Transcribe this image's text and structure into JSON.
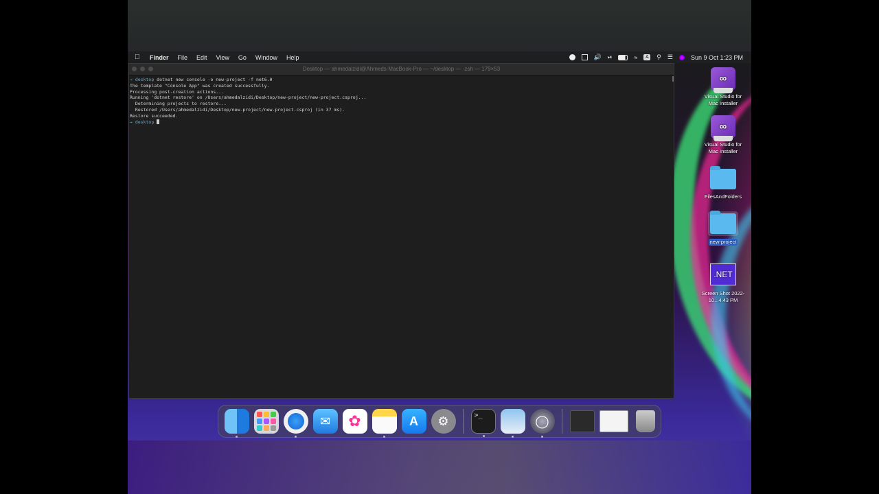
{
  "menubar": {
    "app_name": "Finder",
    "menus": [
      "File",
      "Edit",
      "View",
      "Go",
      "Window",
      "Help"
    ],
    "clock": "Sun 9 Oct  1:23 PM",
    "status_icons": [
      "screen-record-icon",
      "control-grid-icon",
      "volume-icon",
      "play-icon",
      "battery-icon",
      "wifi-icon",
      "input-source-icon",
      "search-icon",
      "control-center-icon",
      "siri-icon"
    ]
  },
  "terminal": {
    "title": "Desktop — ahmedalzidi@Ahmeds-MacBook-Pro — ~/desktop — -zsh — 179×53",
    "lines": [
      {
        "prompt": true,
        "dir": "desktop",
        "text": "dotnet new console -o new-project -f net6.0"
      },
      {
        "prompt": false,
        "text": "The template \"Console App\" was created successfully."
      },
      {
        "prompt": false,
        "text": ""
      },
      {
        "prompt": false,
        "text": "Processing post-creation actions..."
      },
      {
        "prompt": false,
        "text": "Running 'dotnet restore' on /Users/ahmedalzidi/Desktop/new-project/new-project.csproj..."
      },
      {
        "prompt": false,
        "text": "  Determining projects to restore..."
      },
      {
        "prompt": false,
        "text": "  Restored /Users/ahmedalzidi/Desktop/new-project/new-project.csproj (in 37 ms)."
      },
      {
        "prompt": false,
        "text": "Restore succeeded."
      },
      {
        "prompt": false,
        "text": ""
      }
    ],
    "current_prompt": {
      "arrow": "→",
      "dir": "desktop"
    }
  },
  "desktop_icons": [
    {
      "name": "vs-installer-1",
      "label": "Visual Studio for Mac Installer",
      "kind": "vs"
    },
    {
      "name": "vs-installer-2",
      "label": "Visual Studio for Mac Installer",
      "kind": "vs"
    },
    {
      "name": "files-and-folders",
      "label": "FilesAndFolders",
      "kind": "folder"
    },
    {
      "name": "new-project",
      "label": "new-project",
      "kind": "folder",
      "selected": true
    },
    {
      "name": "screen-shot",
      "label": "Screen Shot 2022-10...4.43 PM",
      "kind": "net",
      "badge": ".NET"
    }
  ],
  "dock": {
    "apps": [
      "Finder",
      "Launchpad",
      "Safari",
      "Mail",
      "Photos",
      "Notes",
      "App Store",
      "System Preferences",
      "Terminal",
      "Preview",
      "QuickTime Player",
      "Terminal window",
      "Finder window",
      "Trash"
    ],
    "terminal_glyph": ">_"
  },
  "colors": {
    "terminal_bg": "#1e1e1e",
    "prompt_arrow": "#4ec9b0",
    "prompt_dir": "#5fafd7",
    "selection": "#2f64d2",
    "dotnet_purple": "#512bd4"
  }
}
